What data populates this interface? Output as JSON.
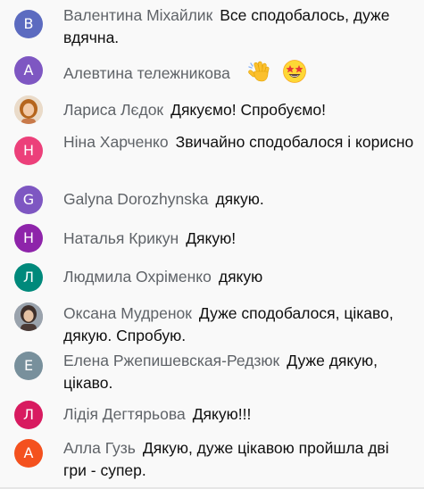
{
  "messages": [
    {
      "initial": "В",
      "avatar_color": "#5c6bc0",
      "author": "Валентина Міхайлик",
      "text": "Все сподобалось, дуже вдячна."
    },
    {
      "initial": "А",
      "avatar_color": "#7e57c2",
      "author": "Алевтина тележникова",
      "text": "",
      "emojis": [
        "waving-hand-icon",
        "star-struck-face-icon"
      ]
    },
    {
      "initial": "",
      "avatar_type": "photo",
      "author": "Лариса Лєдок",
      "text": "Дякуємо! Спробуємо!"
    },
    {
      "initial": "Н",
      "avatar_color": "#ec407a",
      "author": "Ніна Харченко",
      "text": "Звичайно сподобалося і корисно"
    },
    {
      "initial": "G",
      "avatar_color": "#7e57c2",
      "author": "Galyna Dorozhynska",
      "text": "дякую."
    },
    {
      "initial": "Н",
      "avatar_color": "#8e24aa",
      "author": "Наталья Крикун",
      "text": "Дякую!"
    },
    {
      "initial": "Л",
      "avatar_color": "#00897b",
      "author": "Людмила Охріменко",
      "text": "дякую"
    },
    {
      "initial": "",
      "avatar_type": "photo",
      "author": "Оксана Мудренок",
      "text": "Дуже сподобалося, цікаво, дякую. Спробую."
    },
    {
      "initial": "Е",
      "avatar_color": "#78909c",
      "author": "Елена Ржепишевская-Редзюк",
      "text": "Дуже дякую, цікаво."
    },
    {
      "initial": "Л",
      "avatar_color": "#d81b60",
      "author": "Лідія Дегтярьова",
      "text": "Дякую!!!"
    },
    {
      "initial": "А",
      "avatar_color": "#f4511e",
      "author": "Алла Гузь",
      "text": "Дякую, дуже цікавою пройшла дві гри - супер."
    }
  ]
}
